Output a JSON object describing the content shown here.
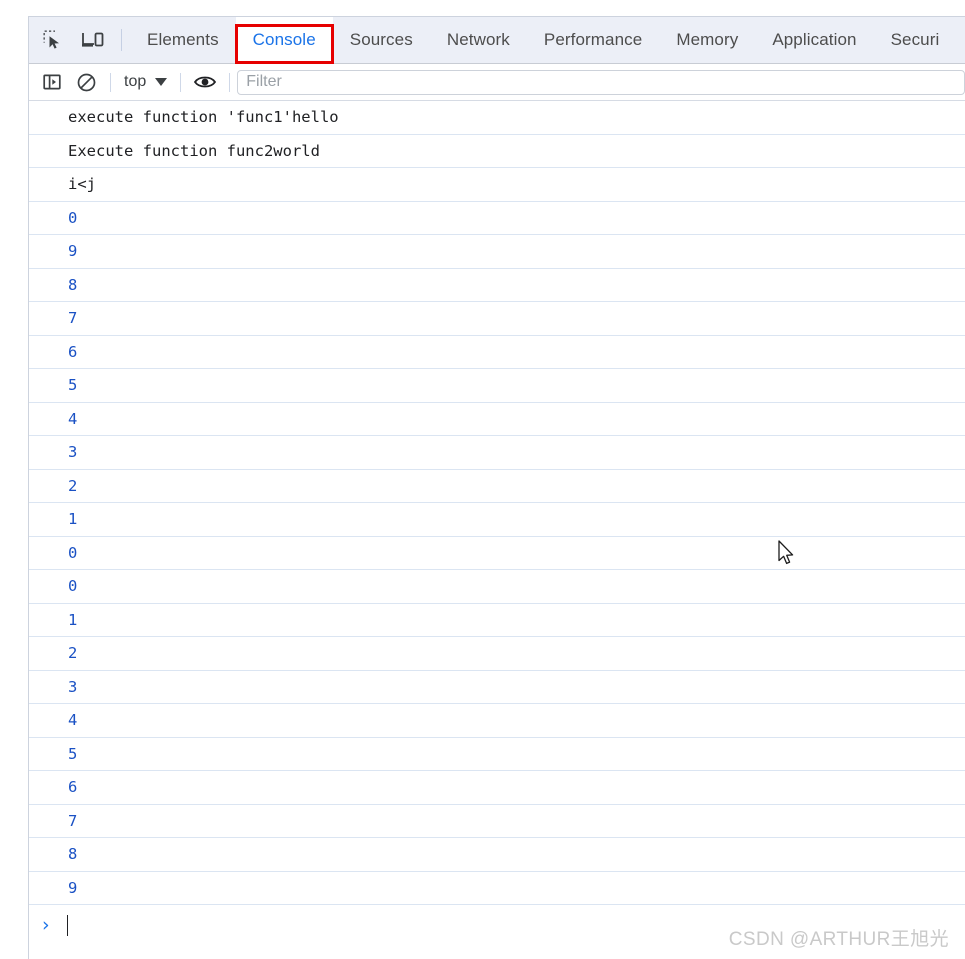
{
  "devtools": {
    "tabbar": {
      "inspect_icon": "inspect-element-icon",
      "device_icon": "device-toolbar-icon",
      "tabs": [
        {
          "label": "Elements",
          "active": false
        },
        {
          "label": "Console",
          "active": true
        },
        {
          "label": "Sources",
          "active": false
        },
        {
          "label": "Network",
          "active": false
        },
        {
          "label": "Performance",
          "active": false
        },
        {
          "label": "Memory",
          "active": false
        },
        {
          "label": "Application",
          "active": false
        },
        {
          "label": "Securi",
          "active": false
        }
      ]
    },
    "console_toolbar": {
      "sidebar_icon": "console-sidebar-icon",
      "clear_icon": "clear-console-icon",
      "context_value": "top",
      "eye_icon": "live-expression-eye-icon",
      "filter_placeholder": "Filter",
      "filter_value": ""
    },
    "messages": [
      {
        "text": "execute function 'func1'hello",
        "kind": "text"
      },
      {
        "text": "Execute function func2world",
        "kind": "text"
      },
      {
        "text": "i<j",
        "kind": "text"
      },
      {
        "text": "0",
        "kind": "num"
      },
      {
        "text": "9",
        "kind": "num"
      },
      {
        "text": "8",
        "kind": "num"
      },
      {
        "text": "7",
        "kind": "num"
      },
      {
        "text": "6",
        "kind": "num"
      },
      {
        "text": "5",
        "kind": "num"
      },
      {
        "text": "4",
        "kind": "num"
      },
      {
        "text": "3",
        "kind": "num"
      },
      {
        "text": "2",
        "kind": "num"
      },
      {
        "text": "1",
        "kind": "num"
      },
      {
        "text": "0",
        "kind": "num"
      },
      {
        "text": "0",
        "kind": "num"
      },
      {
        "text": "1",
        "kind": "num"
      },
      {
        "text": "2",
        "kind": "num"
      },
      {
        "text": "3",
        "kind": "num"
      },
      {
        "text": "4",
        "kind": "num"
      },
      {
        "text": "5",
        "kind": "num"
      },
      {
        "text": "6",
        "kind": "num"
      },
      {
        "text": "7",
        "kind": "num"
      },
      {
        "text": "8",
        "kind": "num"
      },
      {
        "text": "9",
        "kind": "num"
      }
    ],
    "prompt": {
      "chevron": "›",
      "input_value": ""
    }
  },
  "annotation": {
    "target_tab": "Console",
    "box_color": "#e60000"
  },
  "watermark": {
    "text": "CSDN @ARTHUR王旭光"
  },
  "colors": {
    "accent": "#1a73e8",
    "tabbar_bg": "#eceff7",
    "number_text": "#1a51c4",
    "message_text": "#202124",
    "annotation_red": "#e60000"
  }
}
